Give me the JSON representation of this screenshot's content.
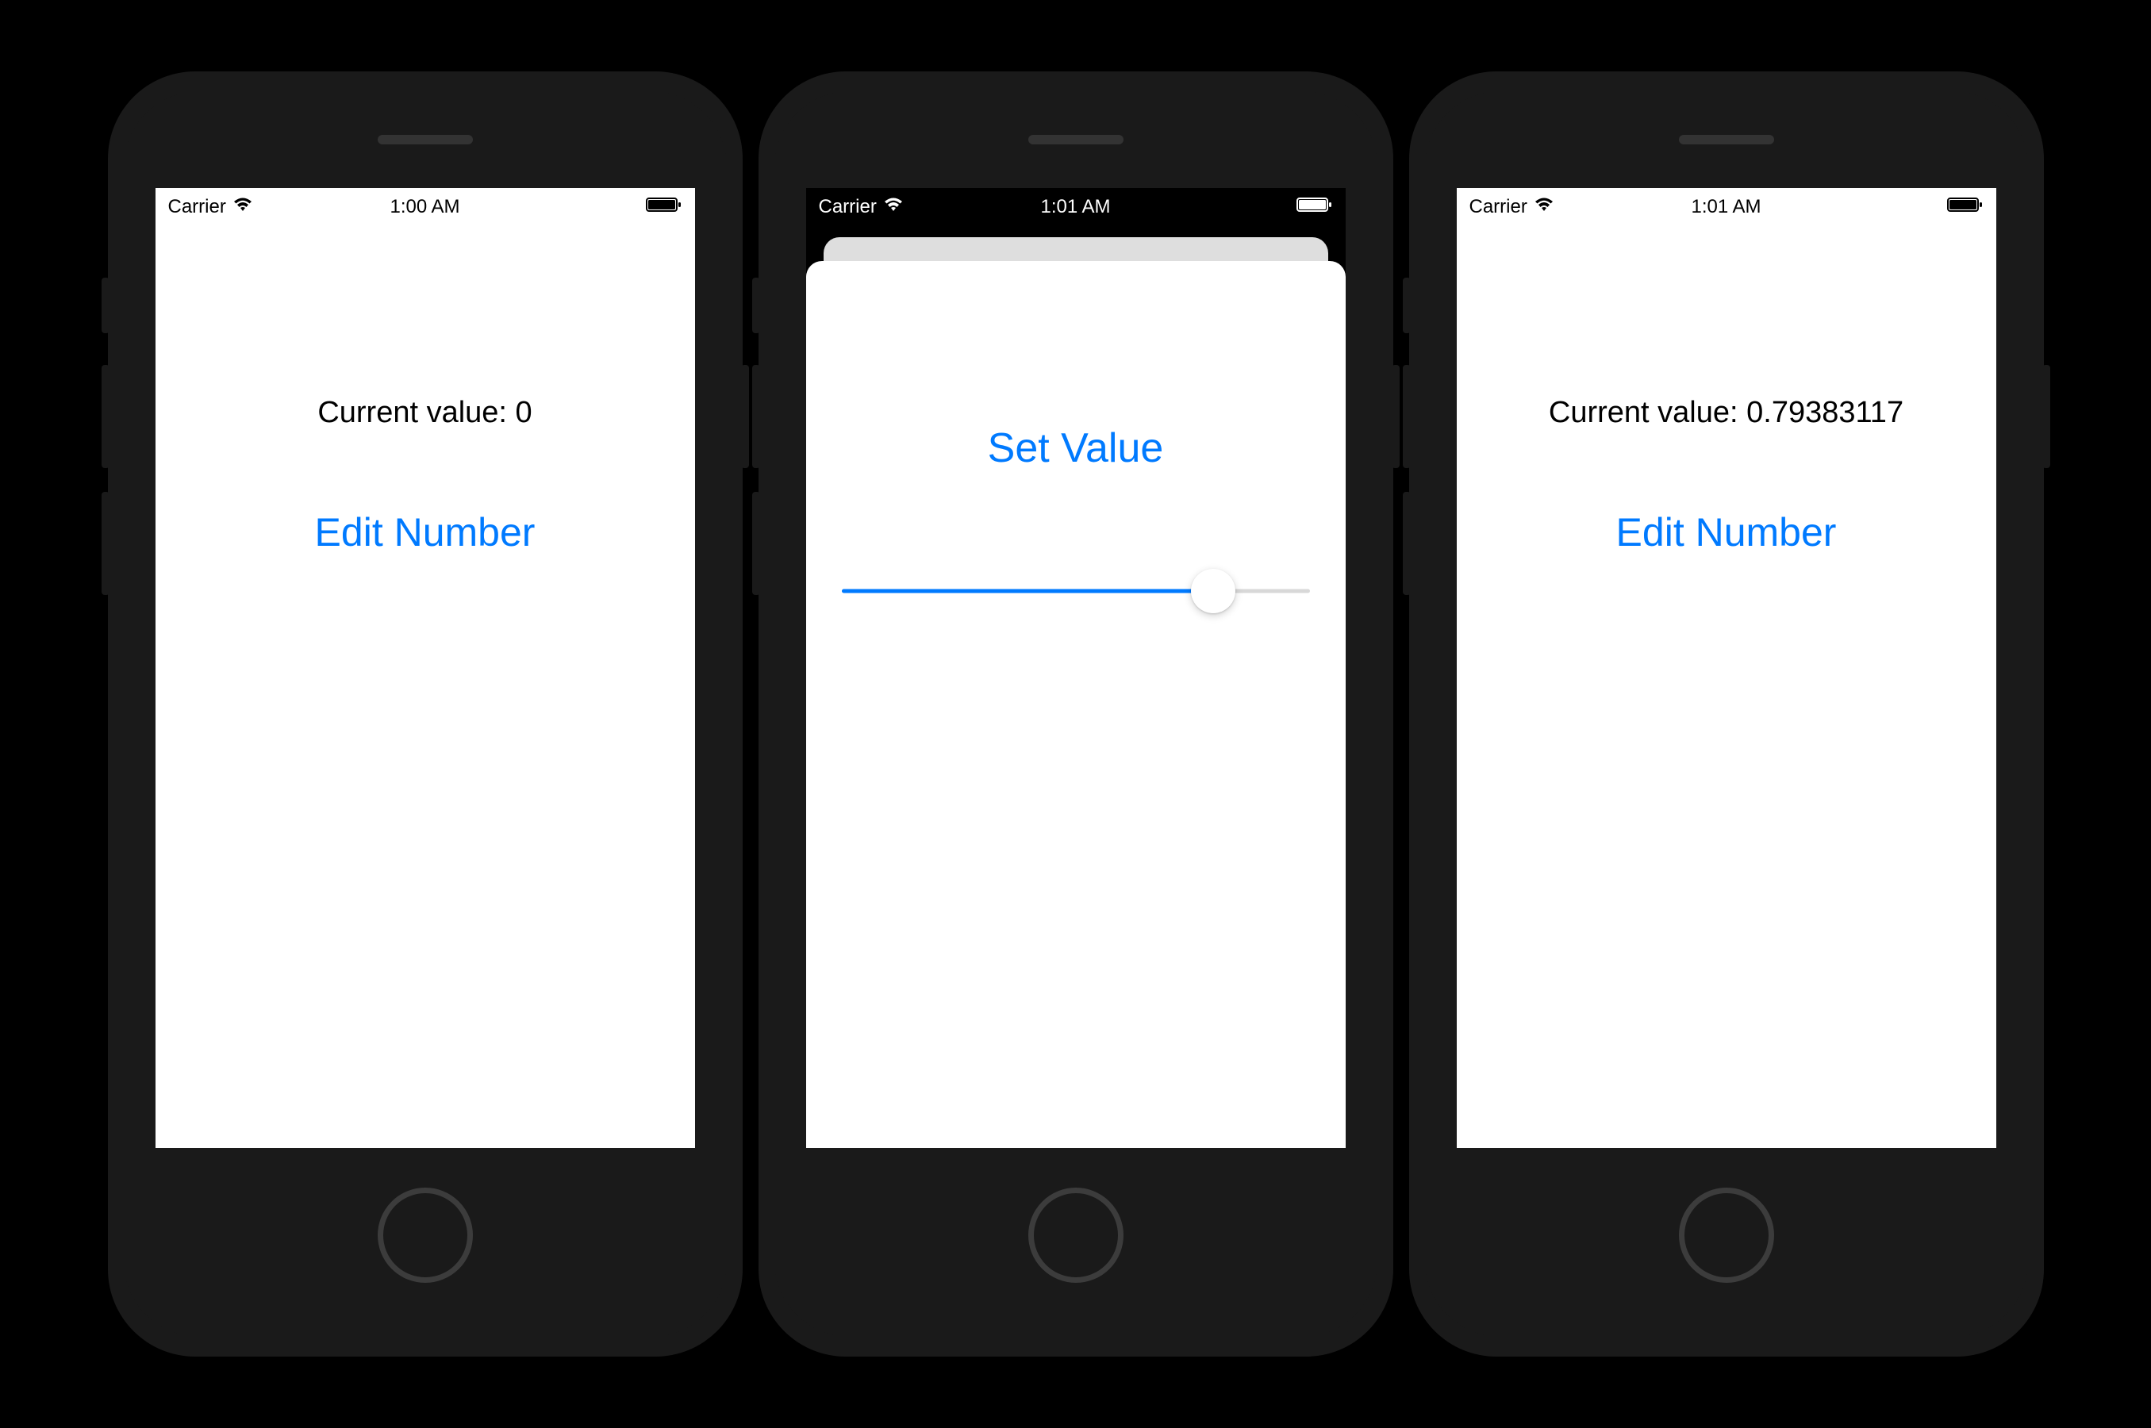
{
  "screens": [
    {
      "status": {
        "carrier": "Carrier",
        "time": "1:00 AM"
      },
      "value_label": "Current value: 0",
      "button_label": "Edit Number"
    },
    {
      "status": {
        "carrier": "Carrier",
        "time": "1:01 AM"
      },
      "modal_title": "Set Value",
      "slider_value": 0.79383117
    },
    {
      "status": {
        "carrier": "Carrier",
        "time": "1:01 AM"
      },
      "value_label": "Current value: 0.79383117",
      "button_label": "Edit Number"
    }
  ],
  "colors": {
    "accent": "#007aff"
  }
}
